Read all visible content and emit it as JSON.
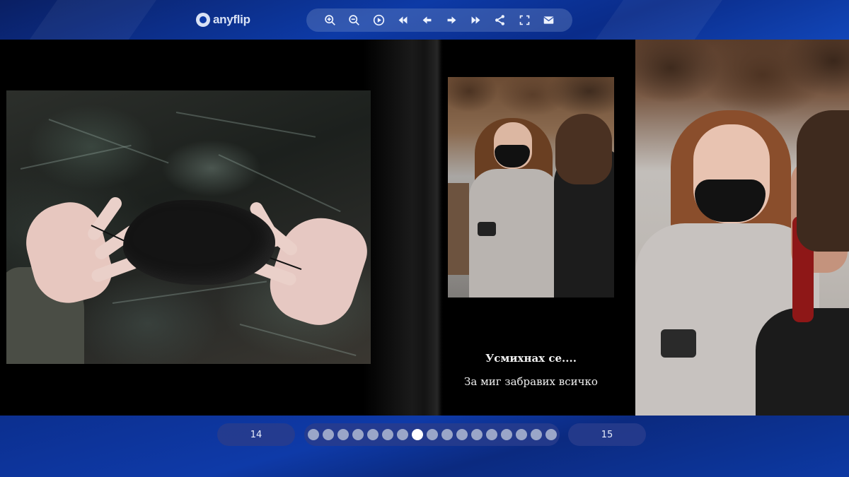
{
  "app": {
    "logo_text": "anyflip"
  },
  "toolbar": {
    "buttons": [
      {
        "name": "zoom-in",
        "icon": "zoom-in-icon"
      },
      {
        "name": "zoom-out",
        "icon": "zoom-out-icon"
      },
      {
        "name": "autoplay",
        "icon": "play-icon"
      },
      {
        "name": "first-page",
        "icon": "first-page-icon"
      },
      {
        "name": "previous-page",
        "icon": "arrow-left-icon"
      },
      {
        "name": "next-page",
        "icon": "arrow-right-icon"
      },
      {
        "name": "last-page",
        "icon": "last-page-icon"
      },
      {
        "name": "share",
        "icon": "share-icon"
      },
      {
        "name": "fullscreen",
        "icon": "fullscreen-icon"
      },
      {
        "name": "email",
        "icon": "mail-icon"
      }
    ]
  },
  "book": {
    "caption_line1": "Усмихнах се....",
    "caption_line2": "За миг забравих всичко"
  },
  "navigation": {
    "left_page": "14",
    "right_page": "15",
    "dot_count": 17,
    "active_dot_index": 7
  },
  "colors": {
    "bar_blue": "#0d3aa6",
    "page_black": "#000000",
    "dot_inactive": "#9aa6c8",
    "dot_active": "#ffffff"
  }
}
